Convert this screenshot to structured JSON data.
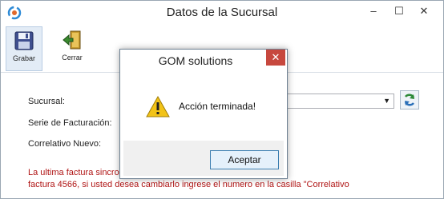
{
  "window": {
    "title": "Datos de la Sucursal",
    "controls": {
      "minimize": "–",
      "maximize": "☐",
      "close": "✕"
    }
  },
  "toolbar": {
    "save_label": "Grabar",
    "close_label": "Cerrar"
  },
  "form": {
    "sucursal_label": "Sucursal:",
    "serie_label": "Serie de Facturación:",
    "correlativo_label": "Correlativo Nuevo:",
    "combo_value": "",
    "note_line1": "La ultima factura sincronizada es 4565 se sugiere iniciar de la",
    "note_line2": "factura 4566, si usted desea cambiarlo ingrese el numero en la casilla \"Correlativo"
  },
  "dialog": {
    "title": "GOM solutions",
    "close_glyph": "✕",
    "message": "Acción terminada!",
    "ok_label": "Aceptar",
    "icon": "warning-icon"
  },
  "colors": {
    "warning_text": "#b01515",
    "dialog_close": "#c7483e",
    "accent_border": "#3c7fb1"
  }
}
